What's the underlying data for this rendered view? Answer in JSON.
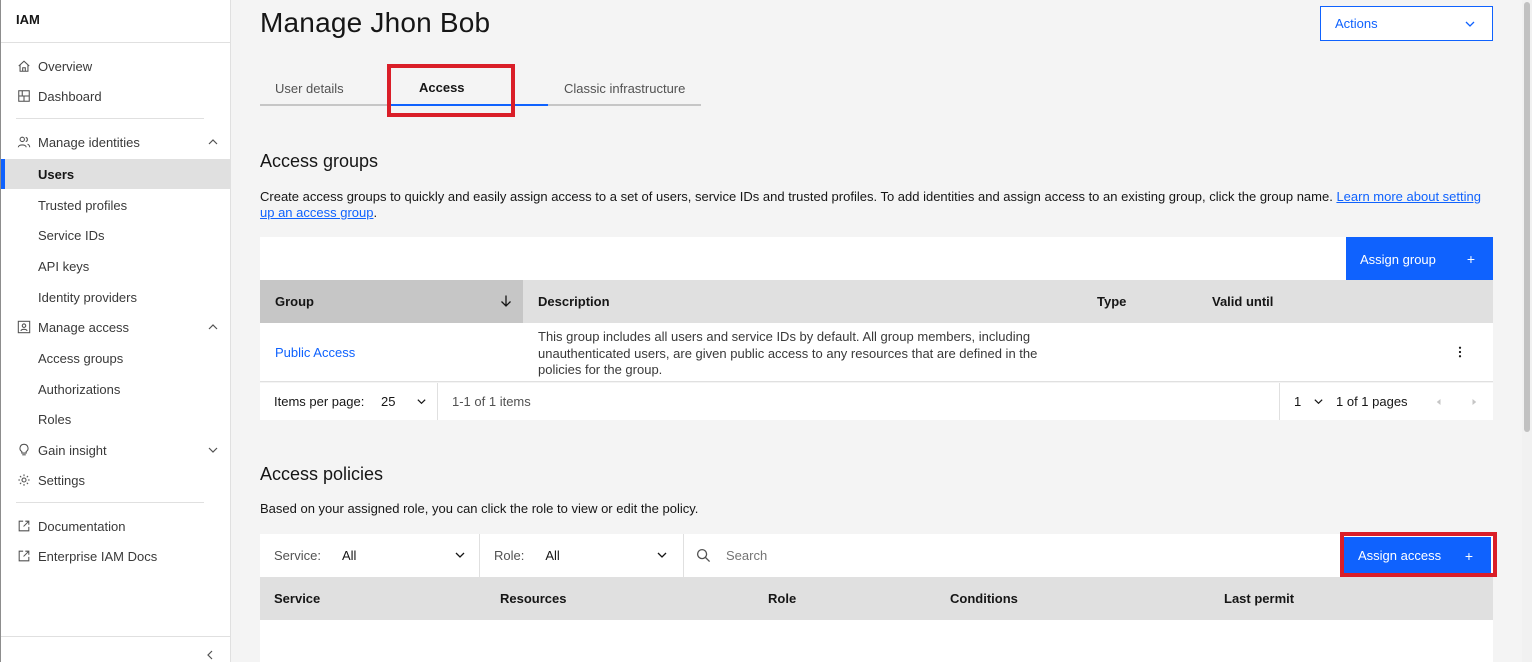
{
  "sidebar": {
    "title": "IAM",
    "items": [
      {
        "label": "Overview",
        "icon": "home-icon"
      },
      {
        "label": "Dashboard",
        "icon": "dashboard-icon"
      },
      {
        "label": "Manage identities",
        "icon": "user-multiple-icon"
      },
      {
        "label": "Users"
      },
      {
        "label": "Trusted profiles"
      },
      {
        "label": "Service IDs"
      },
      {
        "label": "API keys"
      },
      {
        "label": "Identity providers"
      },
      {
        "label": "Manage access",
        "icon": "user-access-icon"
      },
      {
        "label": "Access groups"
      },
      {
        "label": "Authorizations"
      },
      {
        "label": "Roles"
      },
      {
        "label": "Gain insight",
        "icon": "idea-icon"
      },
      {
        "label": "Settings",
        "icon": "settings-icon"
      },
      {
        "label": "Documentation",
        "icon": "launch-icon"
      },
      {
        "label": "Enterprise IAM Docs",
        "icon": "launch-icon"
      }
    ]
  },
  "header": {
    "title": "Manage Jhon Bob",
    "actions_label": "Actions"
  },
  "tabs": [
    {
      "label": "User details"
    },
    {
      "label": "Access",
      "selected": true
    },
    {
      "label": "Classic infrastructure"
    }
  ],
  "access_groups": {
    "heading": "Access groups",
    "description": "Create access groups to quickly and easily assign access to a set of users, service IDs and trusted profiles. To add identities and assign access to an existing group, click the group name. ",
    "link": "Learn more about setting up an access group",
    "description_end": ".",
    "assign_button": "Assign group",
    "columns": [
      "Group",
      "Description",
      "Type",
      "Valid until"
    ],
    "rows": [
      {
        "group": "Public Access",
        "description": "This group includes all users and service IDs by default. All group members, including unauthenticated users, are given public access to any resources that are defined in the policies for the group.",
        "type": "",
        "valid_until": ""
      }
    ],
    "pagination": {
      "items_per_page_label": "Items per page:",
      "items_per_page": "25",
      "range": "1-1 of 1 items",
      "page": "1",
      "pages": "1 of 1 pages"
    }
  },
  "access_policies": {
    "heading": "Access policies",
    "description": "Based on your assigned role, you can click the role to view or edit the policy.",
    "service_filter_label": "Service:",
    "service_filter_value": "All",
    "role_filter_label": "Role:",
    "role_filter_value": "All",
    "search_placeholder": "Search",
    "assign_button": "Assign access",
    "columns": [
      "Service",
      "Resources",
      "Role",
      "Conditions",
      "Last permit"
    ]
  },
  "colors": {
    "primary": "#0f62fe",
    "highlight": "#da1e28"
  }
}
